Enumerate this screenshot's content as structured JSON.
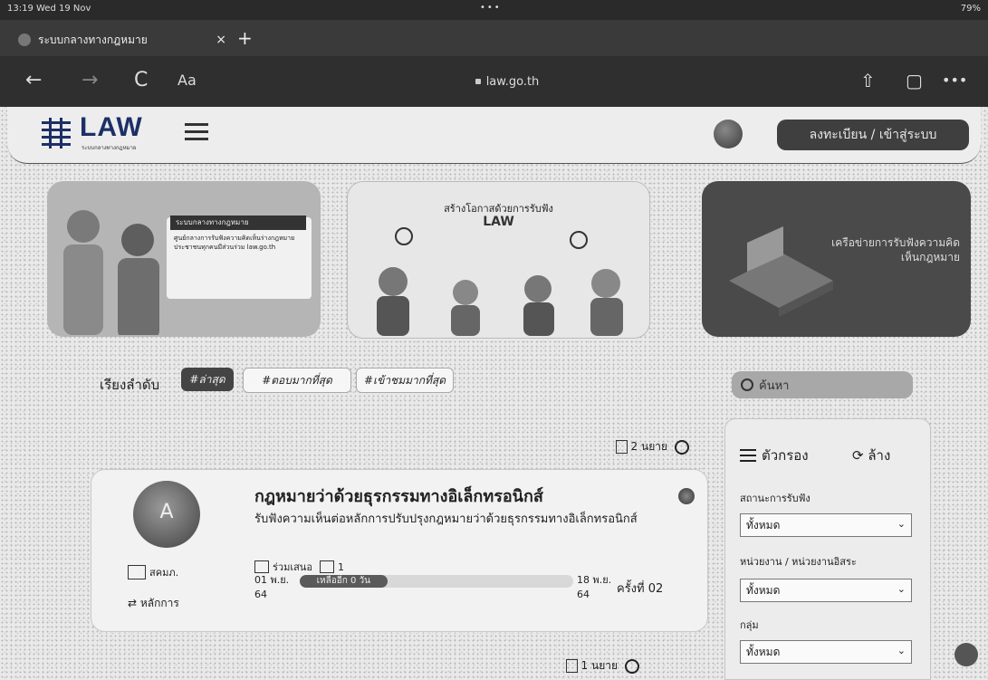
{
  "status_bar": {
    "time": "13:19  Wed 19 Nov",
    "dots": "•••",
    "battery": "79%"
  },
  "browser": {
    "tab_title": "ระบบกลางทางกฎหมาย",
    "tab_close": "×",
    "new_tab": "+",
    "url": "law.go.th",
    "back": "←",
    "forward": "→",
    "reload": "C",
    "reader": "Aa",
    "share": "⇧",
    "tabs": "▢",
    "more": "•••"
  },
  "header": {
    "logo": "LAW",
    "logo_sub": "ระบบกลางทางกฎหมาย",
    "login_button": "ลงทะเบียน / เข้าสู่ระบบ"
  },
  "banners": {
    "banner1_title": "ระบบกลางทางกฎหมาย",
    "banner1_text": "ศูนย์กลางการรับฟังความคิดเห็นร่างกฎหมาย ประชาชนทุกคนมีส่วนร่วม law.go.th",
    "banner2_title": "สร้างโอกาสด้วยการรับฟัง",
    "banner2_logo": "LAW",
    "banner3_text": "เครือข่ายการรับฟังความคิดเห็นกฎหมาย"
  },
  "sort": {
    "label": "เรียงลำดับ",
    "options": [
      "#ล่าสุด",
      "#ตอบมากที่สุด",
      "#เข้าชมมากที่สุด"
    ]
  },
  "search": {
    "placeholder": "ค้นหา"
  },
  "results": {
    "count_label": "2 นยาย",
    "count_label_2": "1 นยาย"
  },
  "card": {
    "title": "กฎหมายว่าด้วยธุรกรรมทางอิเล็กทรอนิกส์",
    "description": "รับฟังความเห็นต่อหลักการปรับปรุงกฎหมายว่าด้วยธุรกรรมทางอิเล็กทรอนิกส์",
    "avatar_glyph": "A",
    "badge": "สคมภ.",
    "status": "หลักการ",
    "participants_label": "ร่วมเสนอ",
    "participants_count": "1",
    "start_date": "01 พ.ย. 64",
    "end_date": "18 พ.ย. 64",
    "progress_label": "เหลืออีก 0 วัน",
    "progress": 0.32,
    "round": "ครั้งที่ 02"
  },
  "filters": {
    "header": "ตัวกรอง",
    "reset": "ล้าง",
    "status_label": "สถานะการรับฟัง",
    "status_value": "ทั้งหมด",
    "agency_label": "หน่วยงาน / หน่วยงานอิสระ",
    "agency_value": "ทั้งหมด",
    "group_label": "กลุ่ม",
    "group_value": "ทั้งหมด"
  },
  "colors": {
    "brand": "#1d2f66",
    "button": "#3f3f3f"
  }
}
